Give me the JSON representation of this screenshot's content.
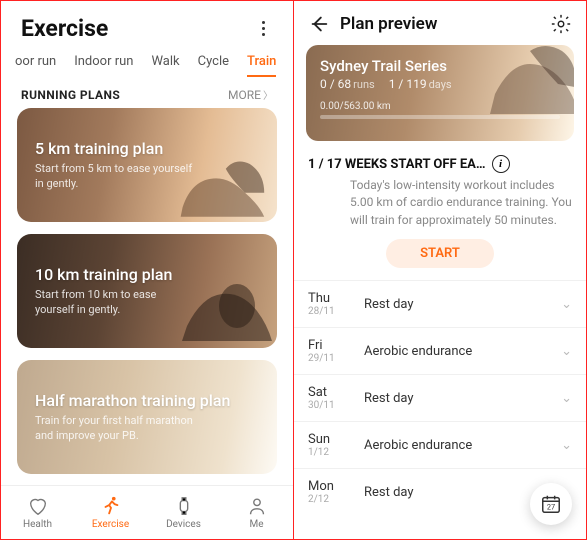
{
  "left": {
    "title": "Exercise",
    "tabs": [
      "oor run",
      "Indoor run",
      "Walk",
      "Cycle",
      "Train"
    ],
    "section_title": "RUNNING PLANS",
    "more_label": "MORE",
    "cards": [
      {
        "title": "5 km training plan",
        "sub": "Start from 5 km to ease yourself in gently."
      },
      {
        "title": "10 km training plan",
        "sub": "Start from 10 km to ease yourself in gently."
      },
      {
        "title": "Half marathon training plan",
        "sub": "Train for your first half marathon and improve your PB."
      }
    ],
    "nav": [
      {
        "label": "Health"
      },
      {
        "label": "Exercise"
      },
      {
        "label": "Devices"
      },
      {
        "label": "Me"
      }
    ]
  },
  "right": {
    "title": "Plan preview",
    "hero": {
      "title": "Sydney Trail Series",
      "runs_done": "0",
      "runs_total": "68",
      "runs_unit": "runs",
      "days_done": "1",
      "days_total": "119",
      "days_unit": "days",
      "distance": "0.00/563.00 km"
    },
    "week_label": "1 / 17 WEEKS  START OFF EA…",
    "week_desc": "Today's low-intensity workout includes 5.00 km of cardio endurance training. You will train for approximately 50 minutes.",
    "start_label": "START",
    "schedule": [
      {
        "dow": "Thu",
        "date": "28/11",
        "label": "Rest day"
      },
      {
        "dow": "Fri",
        "date": "29/11",
        "label": "Aerobic endurance"
      },
      {
        "dow": "Sat",
        "date": "30/11",
        "label": "Rest day"
      },
      {
        "dow": "Sun",
        "date": "1/12",
        "label": "Aerobic endurance"
      },
      {
        "dow": "Mon",
        "date": "2/12",
        "label": "Rest day"
      }
    ],
    "calendar_day": "27"
  }
}
